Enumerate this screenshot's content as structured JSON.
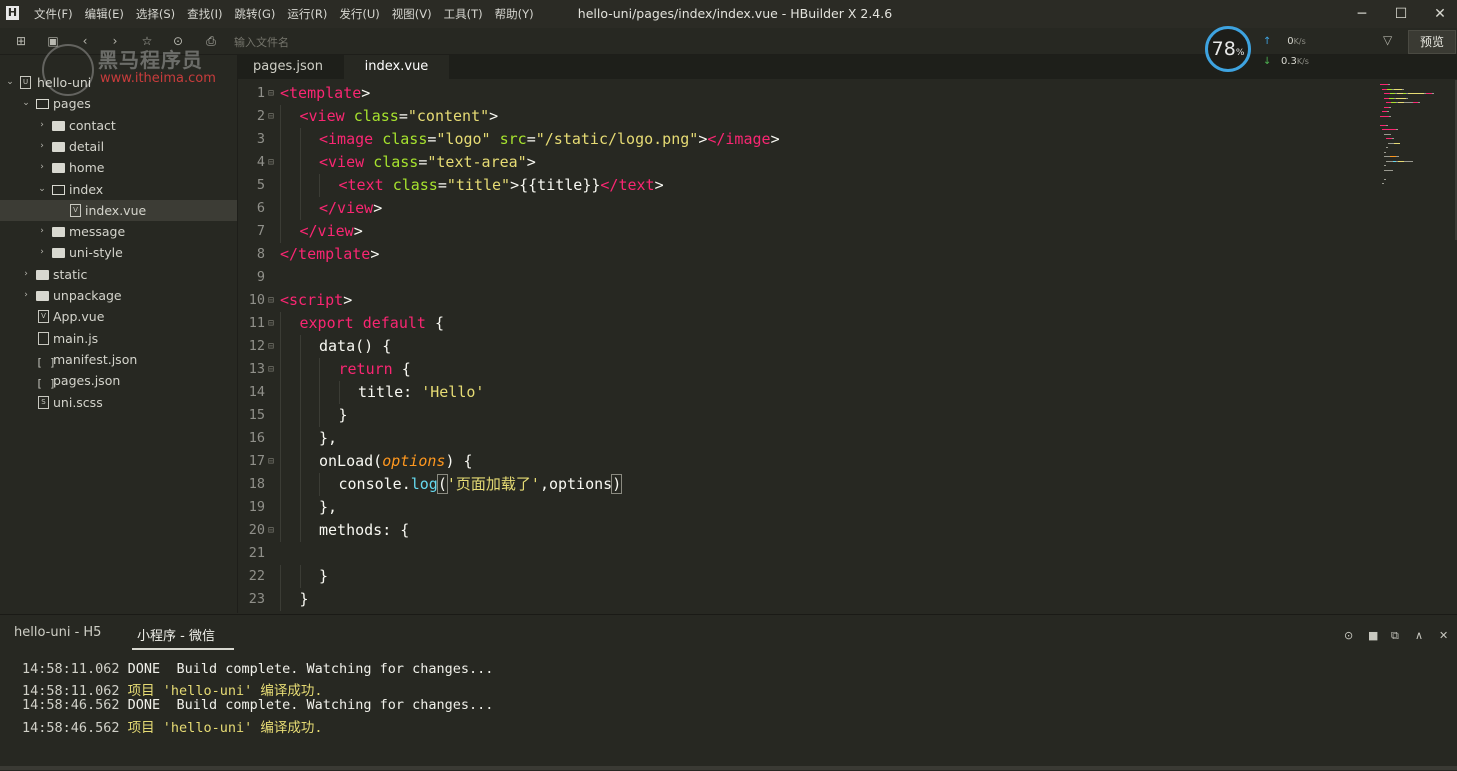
{
  "window": {
    "title": "hello-uni/pages/index/index.vue - HBuilder X 2.4.6",
    "logo": "H",
    "minimize": "─",
    "maximize": "☐",
    "close": "✕"
  },
  "menu": [
    "文件(F)",
    "编辑(E)",
    "选择(S)",
    "查找(I)",
    "跳转(G)",
    "运行(R)",
    "发行(U)",
    "视图(V)",
    "工具(T)",
    "帮助(Y)"
  ],
  "toolbar": {
    "filter_placeholder": "输入文件名",
    "preview_label": "预览"
  },
  "watermark": {
    "name": "黑马程序员",
    "url": "www.itheima.com"
  },
  "net_widget": {
    "cpu": "78",
    "cpu_unit": "%",
    "up": "0",
    "down": "0.3",
    "unit": "K/s",
    "accent": "#3ea3e0"
  },
  "sidebar": {
    "items": [
      {
        "label": "hello-uni",
        "level": 0,
        "type": "project",
        "expanded": true
      },
      {
        "label": "pages",
        "level": 1,
        "type": "folder",
        "expanded": true
      },
      {
        "label": "contact",
        "level": 2,
        "type": "folder",
        "expanded": false
      },
      {
        "label": "detail",
        "level": 2,
        "type": "folder",
        "expanded": false
      },
      {
        "label": "home",
        "level": 2,
        "type": "folder",
        "expanded": false
      },
      {
        "label": "index",
        "level": 2,
        "type": "folder",
        "expanded": true
      },
      {
        "label": "index.vue",
        "level": 3,
        "type": "vue",
        "selected": true
      },
      {
        "label": "message",
        "level": 2,
        "type": "folder",
        "expanded": false
      },
      {
        "label": "uni-style",
        "level": 2,
        "type": "folder",
        "expanded": false
      },
      {
        "label": "static",
        "level": 1,
        "type": "folder",
        "expanded": false
      },
      {
        "label": "unpackage",
        "level": 1,
        "type": "folder",
        "expanded": false
      },
      {
        "label": "App.vue",
        "level": 1,
        "type": "vue"
      },
      {
        "label": "main.js",
        "level": 1,
        "type": "js"
      },
      {
        "label": "manifest.json",
        "level": 1,
        "type": "json"
      },
      {
        "label": "pages.json",
        "level": 1,
        "type": "json"
      },
      {
        "label": "uni.scss",
        "level": 1,
        "type": "scss"
      }
    ]
  },
  "tabs": [
    {
      "label": "pages.json",
      "active": false
    },
    {
      "label": "index.vue",
      "active": true
    }
  ],
  "editor": {
    "lines": [
      {
        "n": "1",
        "fold": "⊟",
        "indent": 0,
        "tokens": [
          [
            "tag",
            "<template"
          ],
          [
            "br",
            ">"
          ]
        ]
      },
      {
        "n": "2",
        "fold": "⊟",
        "indent": 1,
        "tokens": [
          [
            "tag",
            "<view "
          ],
          [
            "attr",
            "class"
          ],
          [
            "br",
            "="
          ],
          [
            "str",
            "\"content\""
          ],
          [
            "br",
            ">"
          ]
        ]
      },
      {
        "n": "3",
        "fold": "",
        "indent": 2,
        "tokens": [
          [
            "tag",
            "<image "
          ],
          [
            "attr",
            "class"
          ],
          [
            "br",
            "="
          ],
          [
            "str",
            "\"logo\" "
          ],
          [
            "attr",
            "src"
          ],
          [
            "br",
            "="
          ],
          [
            "str",
            "\"/static/logo.png\""
          ],
          [
            "br",
            ">"
          ],
          [
            "tag",
            "</image"
          ],
          [
            "br",
            ">"
          ]
        ]
      },
      {
        "n": "4",
        "fold": "⊟",
        "indent": 2,
        "tokens": [
          [
            "tag",
            "<view "
          ],
          [
            "attr",
            "class"
          ],
          [
            "br",
            "="
          ],
          [
            "str",
            "\"text-area\""
          ],
          [
            "br",
            ">"
          ]
        ]
      },
      {
        "n": "5",
        "fold": "",
        "indent": 3,
        "tokens": [
          [
            "tag",
            "<text "
          ],
          [
            "attr",
            "class"
          ],
          [
            "br",
            "="
          ],
          [
            "str",
            "\"title\""
          ],
          [
            "br",
            ">{{title}}"
          ],
          [
            "tag",
            "</text"
          ],
          [
            "br",
            ">"
          ]
        ]
      },
      {
        "n": "6",
        "fold": "",
        "indent": 2,
        "tokens": [
          [
            "tag",
            "</view"
          ],
          [
            "br",
            ">"
          ]
        ]
      },
      {
        "n": "7",
        "fold": "",
        "indent": 1,
        "tokens": [
          [
            "tag",
            "</view"
          ],
          [
            "br",
            ">"
          ]
        ]
      },
      {
        "n": "8",
        "fold": "",
        "indent": 0,
        "tokens": [
          [
            "tag",
            "</template"
          ],
          [
            "br",
            ">"
          ]
        ]
      },
      {
        "n": "9",
        "fold": "",
        "indent": 0,
        "tokens": []
      },
      {
        "n": "10",
        "fold": "⊟",
        "indent": 0,
        "tokens": [
          [
            "tag",
            "<script"
          ],
          [
            "br",
            ">"
          ]
        ]
      },
      {
        "n": "11",
        "fold": "⊟",
        "indent": 1,
        "tokens": [
          [
            "kw",
            "export default "
          ],
          [
            "br",
            "{"
          ]
        ]
      },
      {
        "n": "12",
        "fold": "⊟",
        "indent": 2,
        "tokens": [
          [
            "br",
            "data() {"
          ]
        ]
      },
      {
        "n": "13",
        "fold": "⊟",
        "indent": 3,
        "tokens": [
          [
            "kw",
            "return "
          ],
          [
            "br",
            "{"
          ]
        ]
      },
      {
        "n": "14",
        "fold": "",
        "indent": 4,
        "tokens": [
          [
            "br",
            "title: "
          ],
          [
            "str",
            "'Hello'"
          ]
        ]
      },
      {
        "n": "15",
        "fold": "",
        "indent": 3,
        "tokens": [
          [
            "br",
            "}"
          ]
        ]
      },
      {
        "n": "16",
        "fold": "",
        "indent": 2,
        "tokens": [
          [
            "br",
            "},"
          ]
        ]
      },
      {
        "n": "17",
        "fold": "⊟",
        "indent": 2,
        "tokens": [
          [
            "br",
            "onLoad("
          ],
          [
            "param",
            "options"
          ],
          [
            "br",
            ") {"
          ]
        ]
      },
      {
        "n": "18",
        "fold": "",
        "indent": 3,
        "tokens": [
          [
            "br",
            "console."
          ],
          [
            "fn",
            "log"
          ],
          [
            "brm",
            "("
          ],
          [
            "str",
            "'页面加载了'"
          ],
          [
            "br",
            ",options"
          ],
          [
            "brm",
            ")"
          ]
        ]
      },
      {
        "n": "19",
        "fold": "",
        "indent": 2,
        "tokens": [
          [
            "br",
            "},"
          ]
        ]
      },
      {
        "n": "20",
        "fold": "⊟",
        "indent": 2,
        "tokens": [
          [
            "br",
            "methods: {"
          ]
        ]
      },
      {
        "n": "21",
        "fold": "",
        "indent": 0,
        "tokens": []
      },
      {
        "n": "22",
        "fold": "",
        "indent": 2,
        "tokens": [
          [
            "br",
            "}"
          ]
        ]
      },
      {
        "n": "23",
        "fold": "",
        "indent": 1,
        "tokens": [
          [
            "br",
            "}"
          ]
        ]
      }
    ]
  },
  "console": {
    "tabs": [
      "hello-uni - H5",
      "小程序 - 微信"
    ],
    "icons": [
      "⊙",
      "■",
      "⧉",
      "∧",
      "✕"
    ],
    "logs": [
      {
        "time": "14:58:11.062",
        "text": " DONE  Build complete. Watching for changes...",
        "kind": "done"
      },
      {
        "time": "14:58:11.062",
        "text": " 项目 'hello-uni' 编译成功.",
        "kind": "yellow"
      },
      {
        "time": "14:58:46.562",
        "text": " DONE  Build complete. Watching for changes...",
        "kind": "done"
      },
      {
        "time": "14:58:46.562",
        "text": " 项目 'hello-uni' 编译成功.",
        "kind": "yellow"
      }
    ]
  }
}
